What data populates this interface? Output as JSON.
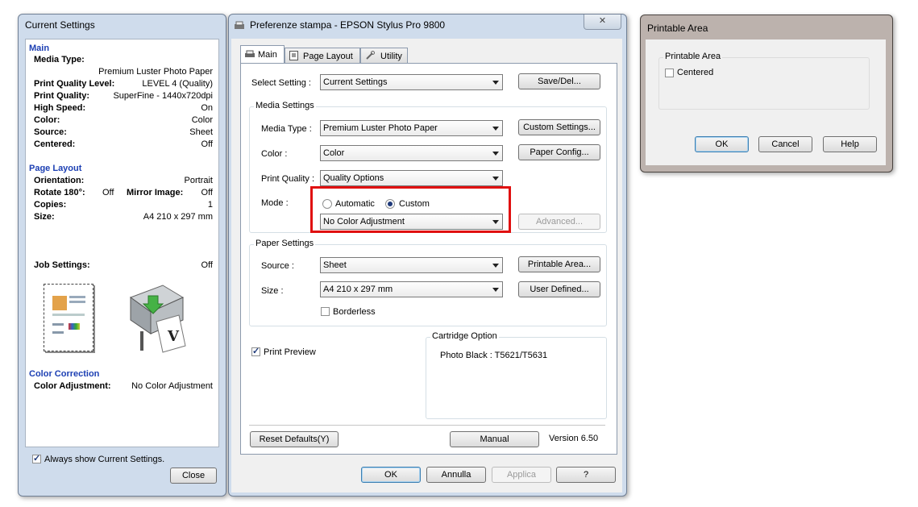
{
  "current_settings": {
    "title": "Current Settings",
    "main_header": "Main",
    "media_type_label": "Media Type:",
    "media_type_value": "Premium Luster Photo Paper",
    "print_quality_level_label": "Print Quality Level:",
    "print_quality_level_value": "LEVEL 4 (Quality)",
    "print_quality_label": "Print Quality:",
    "print_quality_value": "SuperFine - 1440x720dpi",
    "high_speed_label": "High Speed:",
    "high_speed_value": "On",
    "color_label": "Color:",
    "color_value": "Color",
    "source_label": "Source:",
    "source_value": "Sheet",
    "centered_label": "Centered:",
    "centered_value": "Off",
    "page_layout_header": "Page Layout",
    "orientation_label": "Orientation:",
    "orientation_value": "Portrait",
    "rotate_label": "Rotate 180°:",
    "rotate_value": "Off",
    "mirror_label": "Mirror Image:",
    "mirror_value": "Off",
    "copies_label": "Copies:",
    "copies_value": "1",
    "size_label": "Size:",
    "size_value": "A4 210 x 297 mm",
    "job_settings_label": "Job Settings:",
    "job_settings_value": "Off",
    "color_correction_header": "Color Correction",
    "color_adjustment_label": "Color Adjustment:",
    "color_adjustment_value": "No Color Adjustment",
    "always_show_label": "Always show Current Settings.",
    "close_button": "Close"
  },
  "main_dialog": {
    "title": "Preferenze stampa - EPSON Stylus Pro 9800",
    "close_glyph": "✕",
    "tabs": [
      "Main",
      "Page Layout",
      "Utility"
    ],
    "select_setting_label": "Select Setting :",
    "select_setting_value": "Current Settings",
    "save_del_button": "Save/Del...",
    "media_settings_legend": "Media Settings",
    "media_type_label": "Media Type :",
    "media_type_value": "Premium Luster Photo Paper",
    "custom_settings_button": "Custom Settings...",
    "color_label": "Color :",
    "color_value": "Color",
    "paper_config_button": "Paper Config...",
    "print_quality_label": "Print Quality :",
    "print_quality_value": "Quality Options",
    "mode_label": "Mode :",
    "automatic_label": "Automatic",
    "custom_label": "Custom",
    "color_adjustment_value": "No Color Adjustment",
    "advanced_button": "Advanced...",
    "paper_settings_legend": "Paper Settings",
    "source_label": "Source :",
    "source_value": "Sheet",
    "printable_area_button": "Printable Area...",
    "size_label": "Size :",
    "size_value": "A4 210 x 297 mm",
    "user_defined_button": "User Defined...",
    "borderless_label": "Borderless",
    "print_preview_label": "Print Preview",
    "cartridge_legend": "Cartridge Option",
    "cartridge_value": "Photo Black : T5621/T5631",
    "reset_defaults_button": "Reset Defaults(Y)",
    "manual_button": "Manual",
    "version_text": "Version 6.50",
    "ok_button": "OK",
    "annulla_button": "Annulla",
    "applica_button": "Applica",
    "help_button": "?"
  },
  "printable_dialog": {
    "title": "Printable Area",
    "group_legend": "Printable Area",
    "centered_label": "Centered",
    "ok_button": "OK",
    "cancel_button": "Cancel",
    "help_button": "Help"
  },
  "colors": {
    "highlight_box": "#e01010",
    "section_header": "#1c3fb3"
  }
}
